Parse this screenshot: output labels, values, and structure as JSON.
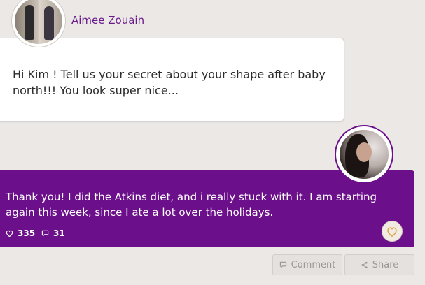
{
  "question": {
    "author": "Aimee Zouain",
    "text": "Hi Kim ! Tell us your secret about your shape after baby north!!! You look super nice..."
  },
  "answer": {
    "text": "Thank you! I did the Atkins diet, and i really stuck with it. I am starting again this week, since I ate a lot over the holidays.",
    "likes": "335",
    "comments": "31"
  },
  "actions": {
    "comment_label": "Comment",
    "share_label": "Share"
  },
  "colors": {
    "accent": "#6c0f8a",
    "background": "#ebe8e6",
    "like_heart": "#e0a040"
  },
  "icons": {
    "likes": "heart-outline-icon",
    "comments": "speech-bubble-icon",
    "like_button": "heart-icon",
    "comment_button": "speech-bubble-icon",
    "share_button": "share-icon"
  }
}
